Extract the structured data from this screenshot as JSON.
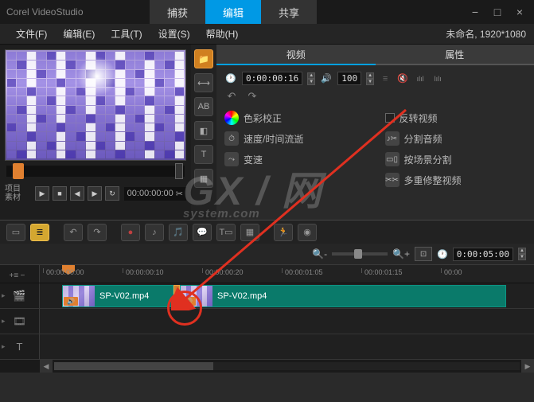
{
  "title_bar": {
    "app_name": "Corel VideoStudio"
  },
  "main_tabs": {
    "capture": "捕获",
    "edit": "编辑",
    "share": "共享",
    "active": "edit"
  },
  "menus": {
    "file": "文件(F)",
    "edit": "编辑(E)",
    "tools": "工具(T)",
    "settings": "设置(S)",
    "help": "帮助(H)"
  },
  "project_info": "未命名, 1920*1080",
  "preview": {
    "mode_label1": "项目",
    "mode_label2": "素材",
    "timecode": "00:00:00:00"
  },
  "property_tabs": {
    "video": "视频",
    "attributes": "属性",
    "active": "video"
  },
  "duration": {
    "value": "0:00:00:16",
    "volume": "100"
  },
  "options": {
    "color_correction": "色彩校正",
    "reverse_video": "反转视频",
    "speed_timelapse": "速度/时间流逝",
    "split_audio": "分割音频",
    "variable_speed": "变速",
    "split_by_scene": "按场景分割",
    "multi_trim": "多重修整视频"
  },
  "zoom": {
    "timecode": "0:00:05:00"
  },
  "ruler_ticks": [
    "00:00:00:00",
    "00:00:00:10",
    "00:00:00:20",
    "00:00:01:05",
    "00:00:01:15",
    "00:00"
  ],
  "clips": {
    "clip1": {
      "label": "SP-V02.mp4"
    },
    "clip2": {
      "label": "SP-V02.mp4"
    }
  },
  "watermark": {
    "main": "GX / 网",
    "sub": "system.com"
  }
}
